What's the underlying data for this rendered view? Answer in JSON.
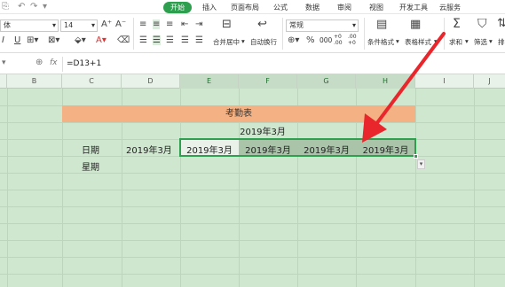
{
  "menubar": {
    "quick_icons": [
      "⎘",
      "↶",
      "↷",
      "▾"
    ],
    "tabs": [
      "开始",
      "插入",
      "页面布局",
      "公式",
      "数据",
      "审阅",
      "视图",
      "开发工具",
      "云服务"
    ],
    "active_color": "#2e9e4f"
  },
  "toolbar": {
    "font_name": "体",
    "font_size": "14",
    "number_format": "常规",
    "merge_label": "合并居中",
    "wrap_label": "自动换行",
    "cond_format_label": "条件格式",
    "table_style_label": "表格样式",
    "sum_label": "求和",
    "filter_label": "筛选",
    "sort_label": "排",
    "percent": "%",
    "thousands": "000",
    "dec_inc": "+0 .00",
    "dec_dec": ".00 +0"
  },
  "formula_bar": {
    "fx": "fx",
    "content": "=D13+1"
  },
  "columns": [
    "B",
    "C",
    "D",
    "E",
    "F",
    "G",
    "H",
    "I",
    "J"
  ],
  "sheet": {
    "title": "考勤表",
    "month": "2019年3月",
    "date_label": "日期",
    "weekday_label": "星期",
    "date_values": [
      "2019年3月",
      "2019年3月",
      "2019年3月",
      "2019年3月",
      "2019年3月"
    ]
  },
  "colors": {
    "grid_bg": "#cfe7cf",
    "title_band": "#f4b183",
    "selection_border": "#2e9e4f",
    "arrow": "#e8262c"
  }
}
